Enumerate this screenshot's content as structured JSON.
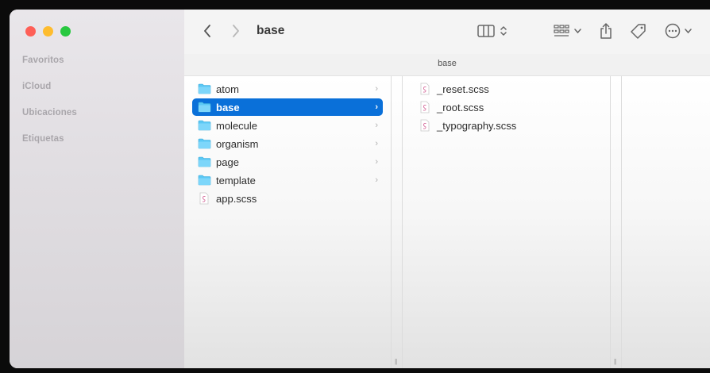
{
  "window": {
    "title": "base"
  },
  "sidebar": {
    "sections": [
      {
        "label": "Favoritos"
      },
      {
        "label": "iCloud"
      },
      {
        "label": "Ubicaciones"
      },
      {
        "label": "Etiquetas"
      }
    ]
  },
  "toolbar": {
    "back_icon": "chevron-left-icon",
    "forward_icon": "chevron-right-icon",
    "view_icon": "columns-view-icon",
    "group_icon": "grid-group-icon",
    "share_icon": "share-icon",
    "tag_icon": "tag-icon",
    "more_icon": "ellipsis-circle-icon"
  },
  "pathbar": {
    "label": "base"
  },
  "columns": [
    {
      "items": [
        {
          "name": "atom",
          "kind": "folder",
          "selected": false
        },
        {
          "name": "base",
          "kind": "folder",
          "selected": true
        },
        {
          "name": "molecule",
          "kind": "folder",
          "selected": false
        },
        {
          "name": "organism",
          "kind": "folder",
          "selected": false
        },
        {
          "name": "page",
          "kind": "folder",
          "selected": false
        },
        {
          "name": "template",
          "kind": "folder",
          "selected": false
        },
        {
          "name": "app.scss",
          "kind": "file",
          "selected": false
        }
      ]
    },
    {
      "items": [
        {
          "name": "_reset.scss",
          "kind": "file"
        },
        {
          "name": "_root.scss",
          "kind": "file"
        },
        {
          "name": "_typography.scss",
          "kind": "file"
        }
      ]
    }
  ],
  "colors": {
    "selection": "#0a70d9",
    "folder": "#5ac8f5"
  }
}
